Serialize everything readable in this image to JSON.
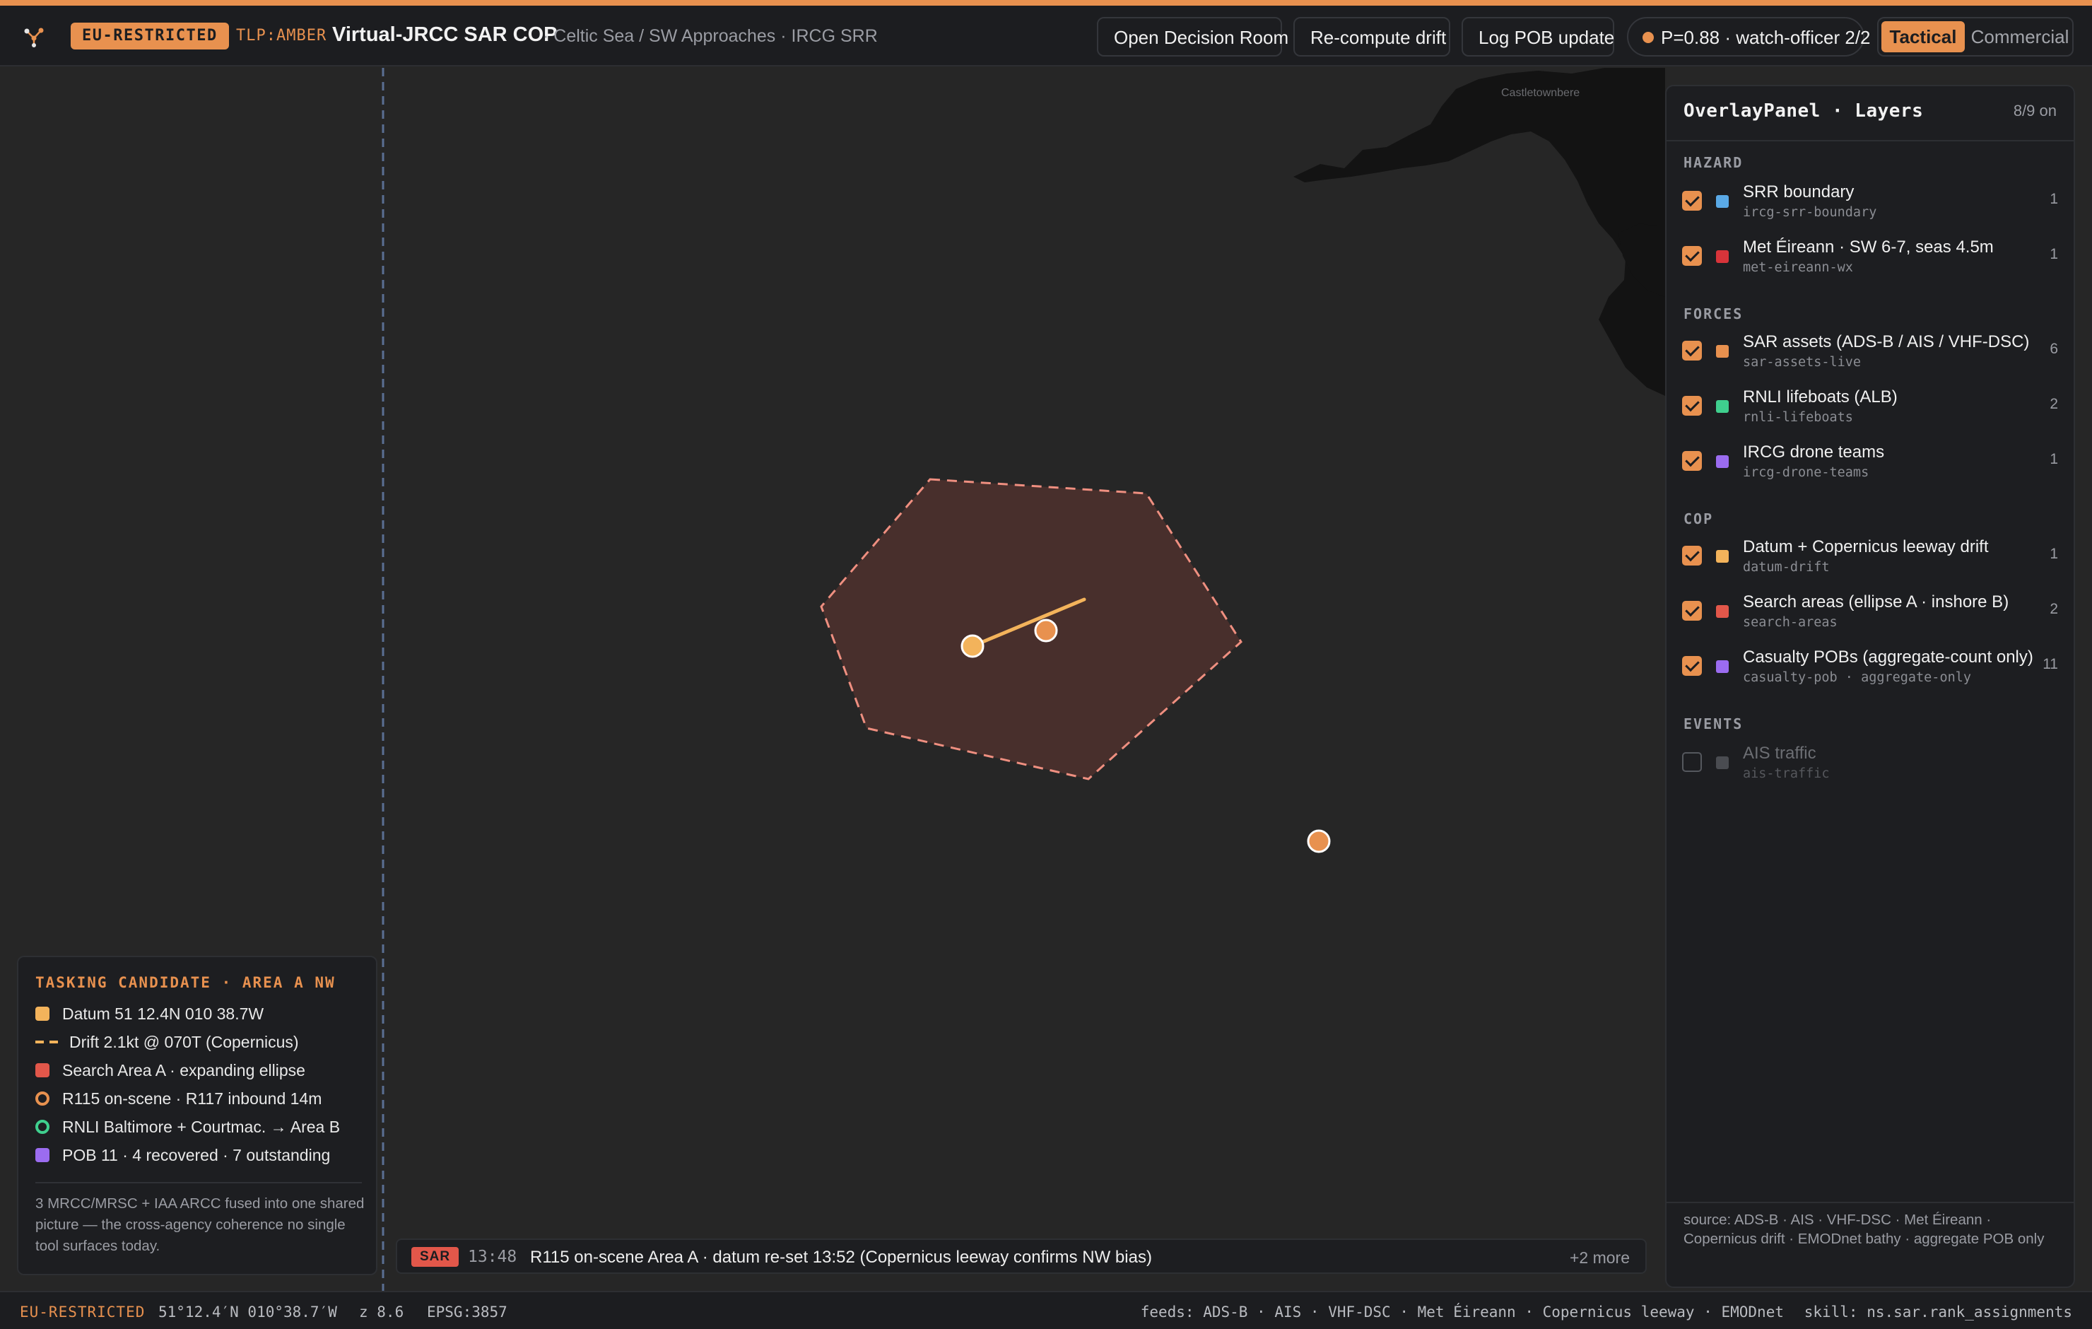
{
  "header": {
    "restriction_badge": "EU-RESTRICTED",
    "tlp": "TLP:AMBER",
    "title": "Virtual-JRCC SAR COP",
    "subtitle": "· Celtic Sea / SW Approaches · IRCG SRR",
    "buttons": {
      "decision_room": "Open Decision Room",
      "recompute_drift": "Re-compute drift",
      "log_pob": "Log POB update"
    },
    "status": "P=0.88 · watch-officer 2/2",
    "modes": {
      "tactical": "Tactical",
      "commercial": "Commercial",
      "active": "tactical"
    }
  },
  "map": {
    "place_label": "Castletownbere",
    "colors": {
      "accent": "#e8914f",
      "datum": "#f3b35b",
      "search_area": "#e2574a",
      "srr_boundary": "#5aa9e6",
      "lifeboat": "#3fcf8e",
      "pob": "#9b6cf0",
      "land": "#131313"
    }
  },
  "tasking": {
    "title": "TASKING CANDIDATE · AREA A NW",
    "items": [
      {
        "label": "Datum 51 12.4N 010 38.7W",
        "kind": "square",
        "color": "#f3b35b"
      },
      {
        "label": "Drift 2.1kt @ 070T (Copernicus)",
        "kind": "dash",
        "color": "#f3b35b"
      },
      {
        "label": "Search Area A · expanding ellipse",
        "kind": "square",
        "color": "#e2574a"
      },
      {
        "label": "R115 on-scene · R117 inbound 14m",
        "kind": "ring",
        "color": "#e8914f"
      },
      {
        "label": "RNLI Baltimore + Courtmac. → Area B",
        "kind": "ring",
        "color": "#3fcf8e"
      },
      {
        "label": "POB 11 · 4 recovered · 7 outstanding",
        "kind": "square",
        "color": "#9b6cf0"
      }
    ],
    "note": "3 MRCC/MRSC + IAA ARCC fused into one shared picture — the cross-agency coherence no single tool surfaces today."
  },
  "ticker": {
    "tag": "SAR",
    "time": "13:48",
    "text": "R115 on-scene Area A · datum re-set 13:52 (Copernicus leeway confirms NW bias)",
    "more": "+2 more"
  },
  "overlay": {
    "title": "OverlayPanel · Layers",
    "count": "8/9 on",
    "groups": [
      {
        "label": "HAZARD",
        "layers": [
          {
            "name": "SRR boundary",
            "id": "ircg-srr-boundary",
            "count": "1",
            "color": "#5aa9e6",
            "on": true
          },
          {
            "name": "Met Éireann · SW 6-7, seas 4.5m",
            "id": "met-eireann-wx",
            "count": "1",
            "color": "#d8343a",
            "on": true
          }
        ]
      },
      {
        "label": "FORCES",
        "layers": [
          {
            "name": "SAR assets (ADS-B / AIS / VHF-DSC)",
            "id": "sar-assets-live",
            "count": "6",
            "color": "#e8914f",
            "on": true
          },
          {
            "name": "RNLI lifeboats (ALB)",
            "id": "rnli-lifeboats",
            "count": "2",
            "color": "#3fcf8e",
            "on": true
          },
          {
            "name": "IRCG drone teams",
            "id": "ircg-drone-teams",
            "count": "1",
            "color": "#9b6cf0",
            "on": true
          }
        ]
      },
      {
        "label": "COP",
        "layers": [
          {
            "name": "Datum + Copernicus leeway drift",
            "id": "datum-drift",
            "count": "1",
            "color": "#f3b35b",
            "on": true
          },
          {
            "name": "Search areas (ellipse A · inshore B)",
            "id": "search-areas",
            "count": "2",
            "color": "#e2574a",
            "on": true
          },
          {
            "name": "Casualty POBs (aggregate-count only)",
            "id": "casualty-pob · aggregate-only",
            "count": "11",
            "color": "#9b6cf0",
            "on": true
          }
        ]
      },
      {
        "label": "EVENTS",
        "layers": [
          {
            "name": "AIS traffic",
            "id": "ais-traffic",
            "count": "",
            "color": "#4a4c51",
            "on": false
          }
        ]
      }
    ],
    "source": "source: ADS-B · AIS · VHF-DSC · Met Éireann · Copernicus drift · EMODnet bathy · aggregate POB only"
  },
  "statusbar": {
    "restriction": "EU-RESTRICTED",
    "coords": "51°12.4′N 010°38.7′W",
    "zoom": "z 8.6",
    "epsg": "EPSG:3857",
    "feeds": "feeds: ADS-B · AIS · VHF-DSC · Met Éireann · Copernicus leeway · EMODnet",
    "skill": "skill: ns.sar.rank_assignments"
  }
}
